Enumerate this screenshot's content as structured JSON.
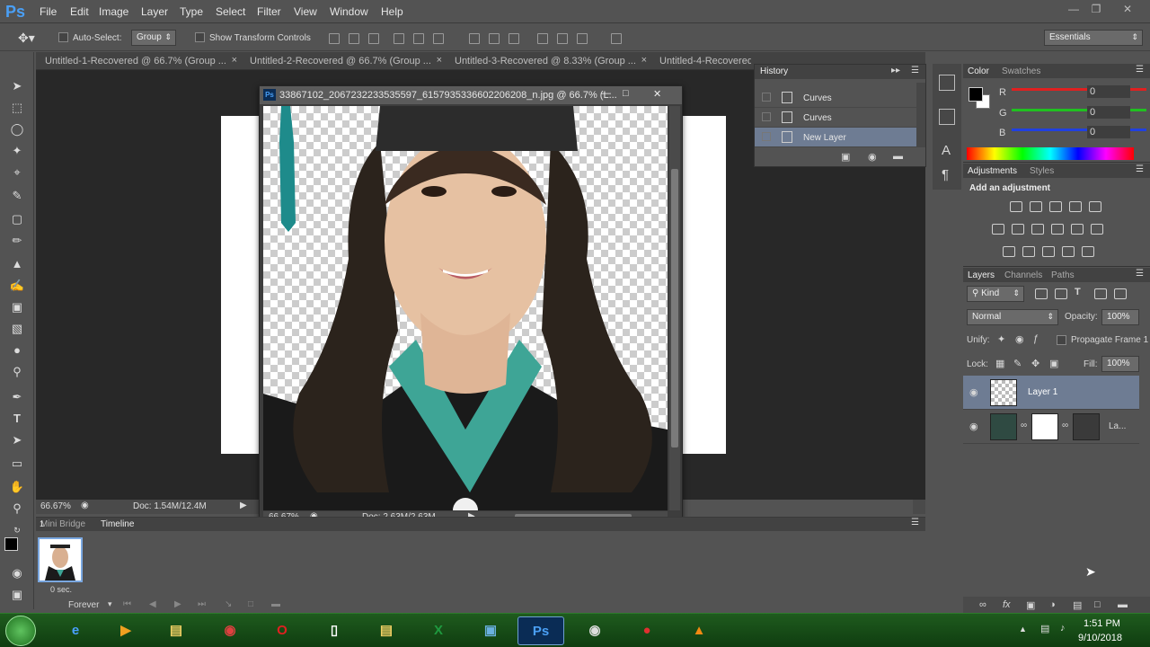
{
  "app": {
    "logo": "Ps"
  },
  "menu": [
    "File",
    "Edit",
    "Image",
    "Layer",
    "Type",
    "Select",
    "Filter",
    "View",
    "Window",
    "Help"
  ],
  "options": {
    "auto_select_label": "Auto-Select:",
    "auto_select_value": "Group",
    "show_transform_label": "Show Transform Controls",
    "workspace": "Essentials"
  },
  "tabs": [
    "Untitled-1-Recovered @ 66.7% (Group ...",
    "Untitled-2-Recovered @ 66.7% (Group ...",
    "Untitled-3-Recovered @ 8.33% (Group ...",
    "Untitled-4-Recovered"
  ],
  "status_main": {
    "zoom": "66.67%",
    "doc": "Doc: 1.54M/12.4M"
  },
  "doc_window": {
    "title": "33867102_2067232233535597_6157935336602206208_n.jpg @ 66.7% (L...",
    "zoom": "66.67%",
    "doc": "Doc: 2.63M/2.63M"
  },
  "history": {
    "title": "History",
    "items": [
      "Curves",
      "Curves",
      "New Layer"
    ]
  },
  "color_panel": {
    "tabs": [
      "Color",
      "Swatches"
    ],
    "channels": [
      {
        "label": "R",
        "value": "0",
        "color": "#e02020"
      },
      {
        "label": "G",
        "value": "0",
        "color": "#20c020"
      },
      {
        "label": "B",
        "value": "0",
        "color": "#2040e0"
      }
    ]
  },
  "adjustments": {
    "tabs": [
      "Adjustments",
      "Styles"
    ],
    "heading": "Add an adjustment"
  },
  "layers_panel": {
    "tabs": [
      "Layers",
      "Channels",
      "Paths"
    ],
    "kind": "Kind",
    "blend_mode": "Normal",
    "opacity_label": "Opacity:",
    "opacity": "100%",
    "unify_label": "Unify:",
    "propagate_label": "Propagate Frame 1",
    "lock_label": "Lock:",
    "fill_label": "Fill:",
    "fill": "100%",
    "layers": [
      {
        "name": "Layer 1"
      },
      {
        "name": "La..."
      }
    ]
  },
  "bottom": {
    "tabs": [
      "Mini Bridge",
      "Timeline"
    ],
    "frame_delay": "0 sec.",
    "loop": "Forever"
  },
  "taskbar": {
    "time": "1:51 PM",
    "date": "9/10/2018"
  }
}
